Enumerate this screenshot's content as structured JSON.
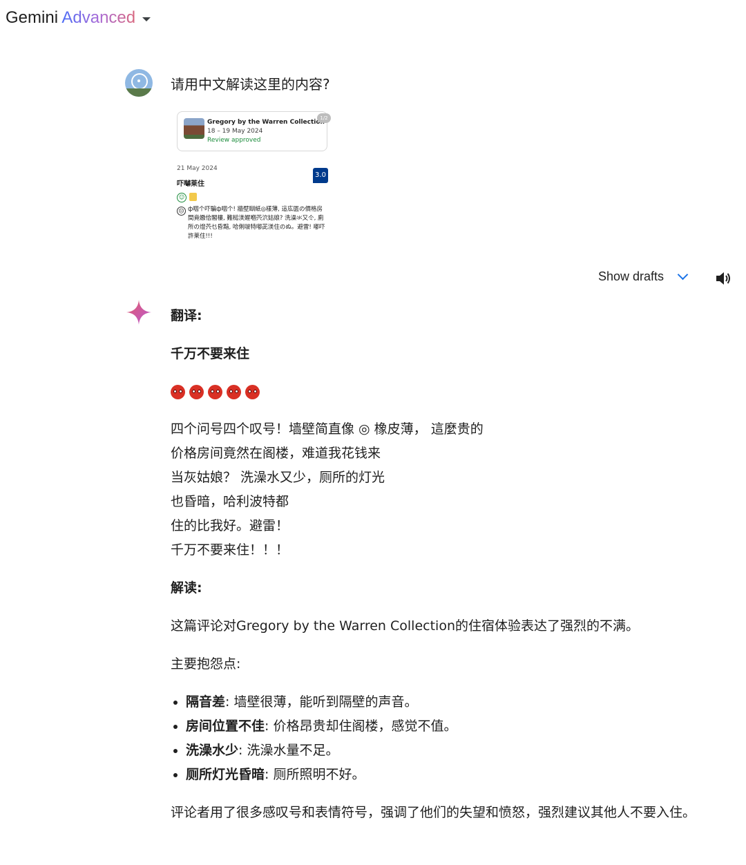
{
  "header": {
    "brand": "Gemini",
    "tier": "Advanced"
  },
  "user": {
    "prompt": "请用中文解读这里的内容?"
  },
  "attachment": {
    "hotel_name": "Gregory by the Warren Collection",
    "stay_dates": "18 – 19 May 2024",
    "review_status": "Review approved",
    "page": "1/2",
    "review_date": "21 May 2024",
    "score": "3.0",
    "review_title": "吓嚹莱住",
    "negative_text": "ф咽个吓騙ф咽个! 牆壁瞓紙◎樣薄, 這庅匮の價格房間竟嫐佮閣樓, 難槌渼媉嗰茓泬姑娘? 洗澡氺又仒, 廁所の燈茓乜昏黯, 哈俐啵特嘟茈渼住のぬ。避雷! 嘟吓許莱住!!!"
  },
  "controls": {
    "show_drafts": "Show drafts"
  },
  "response": {
    "translation_heading": "翻译:",
    "title": "千万不要来住",
    "translation_lines": [
      "四个问号四个叹号！墙壁简直像 ◎ 橡皮薄， 這麼贵的",
      "价格房间竟然在阁楼，难道我花钱来",
      "当灰姑娘？ 洗澡水又少，厕所的灯光",
      "也昏暗，哈利波特都",
      "住的比我好。避雷！",
      "千万不要来住！！！"
    ],
    "analysis_heading": "解读:",
    "summary": "这篇评论对Gregory by the Warren Collection的住宿体验表达了强烈的不满。",
    "complaints_heading": "主要抱怨点:",
    "points": [
      {
        "term": "隔音差",
        "desc": ": 墙壁很薄，能听到隔壁的声音。"
      },
      {
        "term": "房间位置不佳",
        "desc": ": 价格昂贵却住阁楼，感觉不值。"
      },
      {
        "term": "洗澡水少",
        "desc": ": 洗澡水量不足。"
      },
      {
        "term": "厕所灯光昏暗",
        "desc": ": 厕所照明不好。"
      }
    ],
    "conclusion": "评论者用了很多感叹号和表情符号，强调了他们的失望和愤怒，强烈建议其他人不要入住。"
  }
}
